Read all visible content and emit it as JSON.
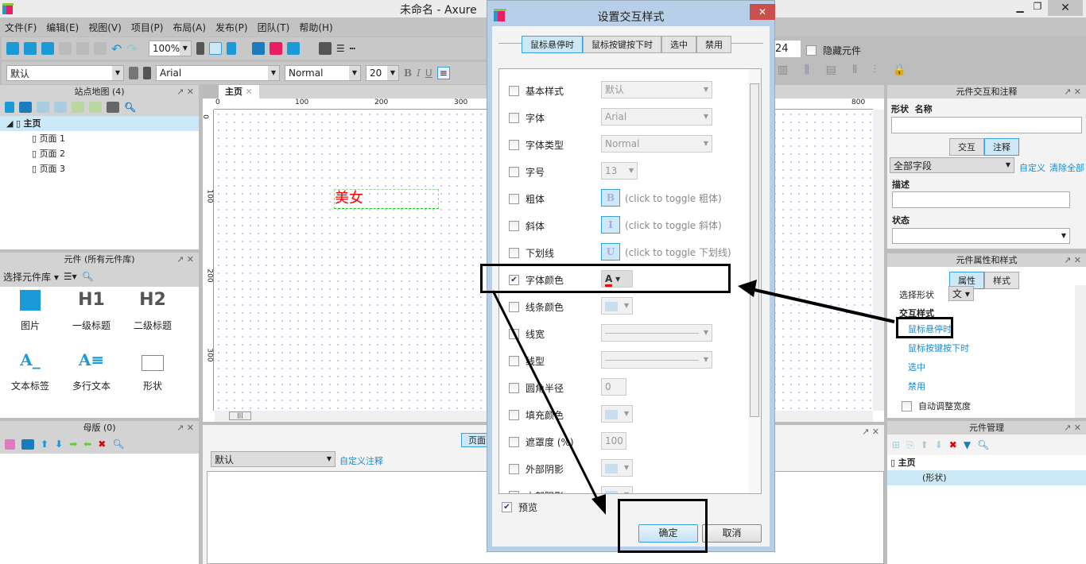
{
  "app": {
    "title": "未命名 - Axure",
    "controls": [
      "minimize",
      "restore",
      "close"
    ]
  },
  "menu": [
    "文件(F)",
    "编辑(E)",
    "视图(V)",
    "项目(P)",
    "布局(A)",
    "发布(P)",
    "团队(T)",
    "帮助(H)"
  ],
  "toolbar": {
    "zoom": "100%",
    "style": "默认",
    "font": "Arial",
    "font_type": "Normal",
    "font_size": "20",
    "coord_value": "24",
    "hide_widgets_label": "隐藏元件"
  },
  "sitemap": {
    "title": "站点地图 (4)",
    "root": "主页",
    "pages": [
      "页面 1",
      "页面 2",
      "页面 3"
    ]
  },
  "widgets": {
    "title": "元件 (所有元件库)",
    "library_label": "选择元件库",
    "items": [
      {
        "icon": "image-icon",
        "label": "图片"
      },
      {
        "icon": "h1-icon",
        "label": "一级标题",
        "glyph": "H1"
      },
      {
        "icon": "h2-icon",
        "label": "二级标题",
        "glyph": "H2"
      },
      {
        "icon": "text-label-icon",
        "label": "文本标签",
        "glyph": "A_"
      },
      {
        "icon": "paragraph-icon",
        "label": "多行文本",
        "glyph": "A≡"
      },
      {
        "icon": "shape-icon",
        "label": "形状"
      }
    ]
  },
  "masters": {
    "title": "母版 (0)"
  },
  "canvas": {
    "tab": "主页",
    "ruler_x": [
      "0",
      "100",
      "200",
      "300",
      "800"
    ],
    "ruler_y": [
      "0",
      "100",
      "200",
      "300"
    ],
    "widget_text": "美女",
    "widget_color": "#ff0000"
  },
  "page_notes": {
    "tab": "页面",
    "select": "默认",
    "custom_link": "自定义注释"
  },
  "interactions_panel": {
    "title": "元件交互和注释",
    "name_label": "形状  名称",
    "tabs": [
      "交互",
      "注释"
    ],
    "active_tab": "注释",
    "fields_select": "全部字段",
    "custom": "自定义",
    "clear_all": "清除全部",
    "desc_label": "描述",
    "status_label": "状态"
  },
  "props_panel": {
    "title": "元件属性和样式",
    "tabs": [
      "属性",
      "样式"
    ],
    "active_tab": "属性",
    "select_shape_label": "选择形状",
    "shape_glyph": "文",
    "interaction_styles_label": "交互样式",
    "styles": [
      "鼠标悬停时",
      "鼠标按键按下时",
      "选中",
      "禁用"
    ],
    "auto_width": "自动调整宽度"
  },
  "outline_panel": {
    "title": "元件管理",
    "root": "主页",
    "item": "(形状)"
  },
  "dialog": {
    "title": "设置交互样式",
    "tabs": [
      "鼠标悬停时",
      "鼠标按键按下时",
      "选中",
      "禁用"
    ],
    "active_tab": "鼠标悬停时",
    "rows": [
      {
        "label": "基本样式",
        "checked": false,
        "value": "默认"
      },
      {
        "label": "字体",
        "checked": false,
        "value": "Arial"
      },
      {
        "label": "字体类型",
        "checked": false,
        "value": "Normal"
      },
      {
        "label": "字号",
        "checked": false,
        "value": "13"
      },
      {
        "label": "粗体",
        "checked": false,
        "glyph": "B",
        "hint": "(click to toggle 粗体)"
      },
      {
        "label": "斜体",
        "checked": false,
        "glyph": "I",
        "hint": "(click to toggle 斜体)"
      },
      {
        "label": "下划线",
        "checked": false,
        "glyph": "U",
        "hint": "(click to toggle 下划线)"
      },
      {
        "label": "字体颜色",
        "checked": true,
        "glyph": "A",
        "color": "#ff0000"
      },
      {
        "label": "线条颜色",
        "checked": false
      },
      {
        "label": "线宽",
        "checked": false
      },
      {
        "label": "线型",
        "checked": false
      },
      {
        "label": "圆角半径",
        "checked": false,
        "value": "0"
      },
      {
        "label": "填充颜色",
        "checked": false
      },
      {
        "label": "遮罩度 (%)",
        "checked": false,
        "value": "100"
      },
      {
        "label": "外部阴影",
        "checked": false
      },
      {
        "label": "内部阴影",
        "checked": false
      }
    ],
    "preview": "预览",
    "preview_checked": true,
    "ok": "确定",
    "cancel": "取消"
  }
}
